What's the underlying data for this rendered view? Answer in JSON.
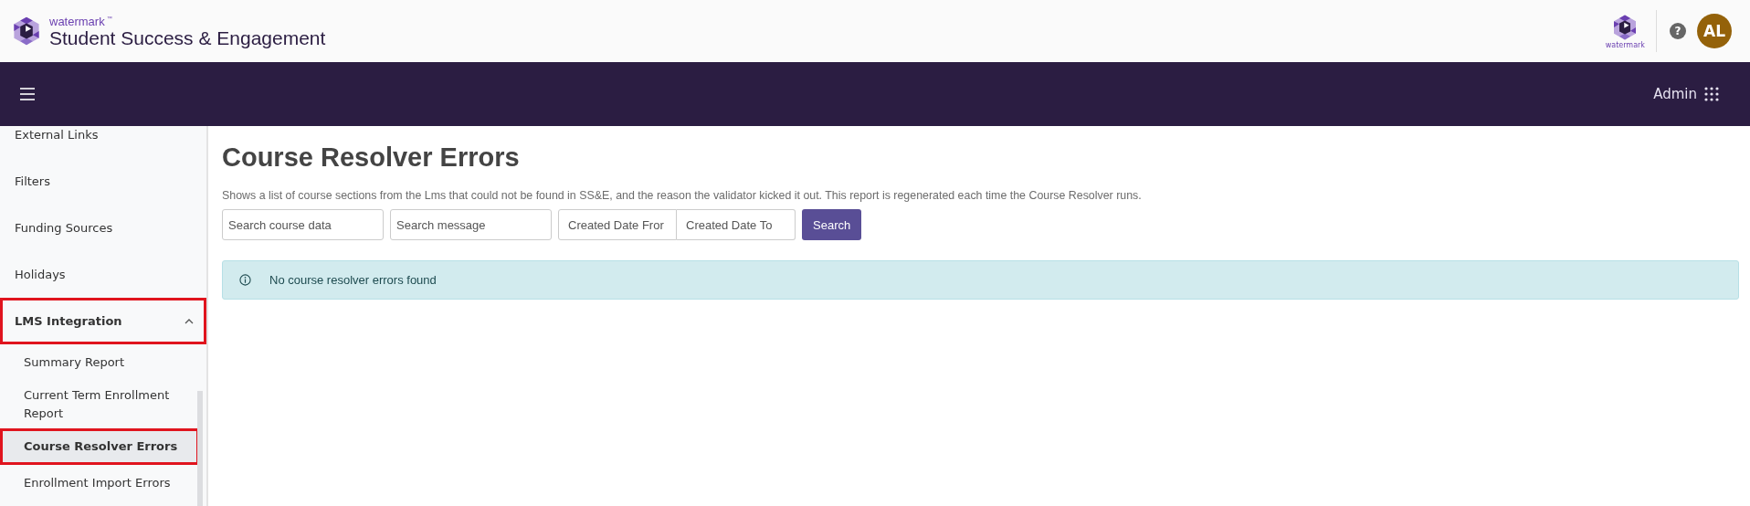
{
  "header": {
    "brand_small": "watermark",
    "brand_tm": "™",
    "product": "Student Success & Engagement",
    "partner_logo_caption": "watermark",
    "help": "?",
    "avatar": "AL"
  },
  "navbar": {
    "menu_label": "Admin"
  },
  "sidebar": {
    "items": [
      {
        "label": "External Links",
        "kind": "link",
        "selected": false,
        "highlighted": false
      },
      {
        "label": "Filters",
        "kind": "link",
        "selected": false,
        "highlighted": false
      },
      {
        "label": "Funding Sources",
        "kind": "link",
        "selected": false,
        "highlighted": false
      },
      {
        "label": "Holidays",
        "kind": "link",
        "selected": false,
        "highlighted": false
      },
      {
        "label": "LMS Integration",
        "kind": "group",
        "expanded": true,
        "selected": false,
        "highlighted": true,
        "children": [
          {
            "label": "Summary Report",
            "selected": false,
            "highlighted": false
          },
          {
            "label": "Current Term Enrollment Report",
            "selected": false,
            "highlighted": false
          },
          {
            "label": "Course Resolver Errors",
            "selected": true,
            "highlighted": true
          },
          {
            "label": "Enrollment Import Errors",
            "selected": false,
            "highlighted": false
          }
        ]
      }
    ]
  },
  "page": {
    "title": "Course Resolver Errors",
    "description": "Shows a list of course sections from the Lms that could not be found in SS&E, and the reason the validator kicked it out. This report is regenerated each time the Course Resolver runs.",
    "filters": [
      {
        "placeholder": "Search course data"
      },
      {
        "placeholder": "Search message"
      }
    ],
    "date_range": [
      {
        "placeholder": "Created Date Fror"
      },
      {
        "placeholder": "Created Date To"
      }
    ],
    "search_button": "Search",
    "alert": "No course resolver errors found"
  }
}
